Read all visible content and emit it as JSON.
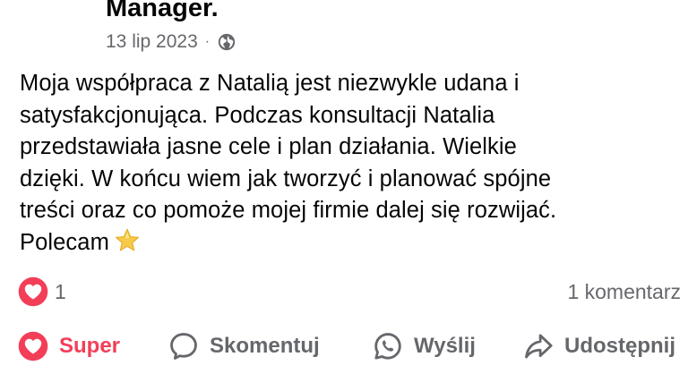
{
  "post": {
    "author": "Manager.",
    "date": "13 lip 2023",
    "separator": "·",
    "audience_icon": "globe-icon",
    "text": "Moja współpraca z Natalią jest niezwykle udana i\nsatysfakcjonująca. Podczas konsultacji Natalia\nprzedstawiała jasne cele i plan działania. Wielkie\ndzięki. W końcu wiem jak tworzyć i planować spójne\ntreści oraz co pomoże mojej firmie dalej się rozwijać.\nPolecam",
    "emoji_icon": "star-icon"
  },
  "engagement": {
    "reaction_icon": "love-reaction-icon",
    "reaction_count": "1",
    "comments_label": "1 komentarz"
  },
  "actions": {
    "super_label": "Super",
    "comment_label": "Skomentuj",
    "send_label": "Wyślij",
    "share_label": "Udostępnij"
  },
  "colors": {
    "super_accent": "#f33e58",
    "secondary_text": "#65676b",
    "primary_text": "#050505",
    "star": "#f7c948"
  }
}
